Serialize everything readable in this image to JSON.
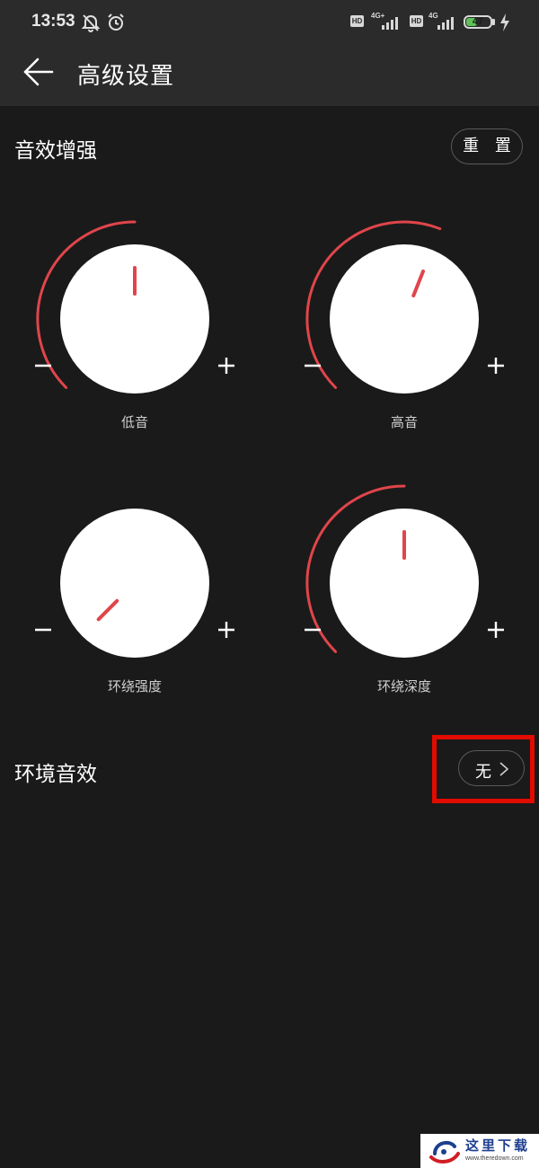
{
  "status_bar": {
    "time": "13:53",
    "hd_label": "HD",
    "network_1": "4G+",
    "network_2": "4G",
    "battery": "47",
    "battery_level": 0.47,
    "icons": [
      "mute-bell-icon",
      "alarm-icon",
      "signal-icon",
      "charging-icon"
    ]
  },
  "header": {
    "title": "高级设置",
    "back_icon": "arrow-left-icon"
  },
  "enhancement": {
    "title": "音效增强",
    "reset_label": "重 置",
    "knobs": [
      {
        "label": "低音",
        "level": 0.5,
        "minus": "−",
        "plus": "+"
      },
      {
        "label": "高音",
        "level": 0.58,
        "minus": "−",
        "plus": "+"
      },
      {
        "label": "环绕强度",
        "level": 0.0,
        "minus": "−",
        "plus": "+"
      },
      {
        "label": "环绕深度",
        "level": 0.5,
        "minus": "−",
        "plus": "+"
      }
    ]
  },
  "ambient": {
    "title": "环境音效",
    "value": "无",
    "chevron_icon": "chevron-right-icon"
  },
  "colors": {
    "accent": "#e0454b",
    "background": "#1a1a1a",
    "header": "#2b2b2b",
    "highlight": "#e10b00"
  },
  "watermark": {
    "text": "这里下载",
    "url": "www.theredown.com"
  }
}
